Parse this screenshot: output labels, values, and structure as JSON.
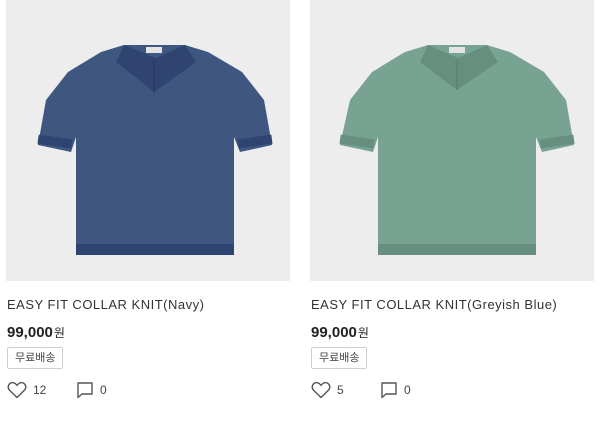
{
  "products": [
    {
      "name": "EASY FIT COLLAR KNIT(Navy)",
      "price": "99,000",
      "currency": "원",
      "badge": "무료배송",
      "likes": "12",
      "comments": "0",
      "shirt_color": "#3e5680",
      "shirt_shade": "#2f4470",
      "image_bg": "#ededed"
    },
    {
      "name": "EASY FIT COLLAR KNIT(Greyish Blue)",
      "price": "99,000",
      "currency": "원",
      "badge": "무료배송",
      "likes": "5",
      "comments": "0",
      "shirt_color": "#78a392",
      "shirt_shade": "#668f80",
      "image_bg": "#ededed"
    }
  ],
  "icons": {
    "like": "heart-icon",
    "comment": "speech-bubble-icon"
  }
}
